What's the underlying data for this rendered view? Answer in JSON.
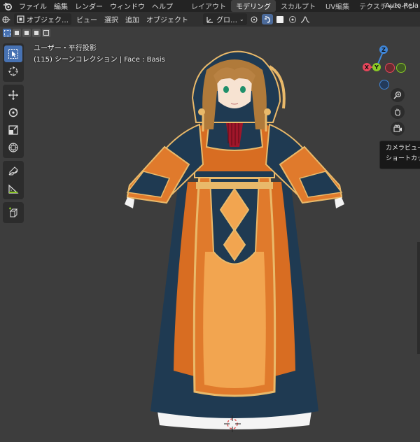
{
  "topbar": {
    "menus": [
      "ファイル",
      "編集",
      "レンダー",
      "ウィンドウ",
      "ヘルプ"
    ],
    "workspace_tabs": [
      {
        "label": "レイアウト",
        "active": false
      },
      {
        "label": "モデリング",
        "active": true
      },
      {
        "label": "スカルプト",
        "active": false
      },
      {
        "label": "UV編集",
        "active": false
      },
      {
        "label": "テクスチャペイン",
        "active": false
      }
    ],
    "right_label": "Auto Rela"
  },
  "header": {
    "mode_dropdown": "オブジェク…",
    "menus": [
      "ビュー",
      "選択",
      "追加",
      "オブジェクト"
    ],
    "orientation_dropdown": "グロ…"
  },
  "viewport": {
    "view_name": "ユーザー・平行投影",
    "collection_info": "(115) シーンコレクション | Face : Basis"
  },
  "gizmo": {
    "z_label": "Z",
    "x_label": "X",
    "y_label": "Y",
    "colors": {
      "x": "#e8465b",
      "y": "#8ac926",
      "z": "#3f86d9"
    }
  },
  "tooltip": {
    "line1": "カメラビュー",
    "line2": "ショートカッ"
  },
  "colors": {
    "accent": "#4772b3",
    "robe_orange": "#e2782f",
    "robe_navy": "#1f3a52",
    "trim_gold": "#e9b96a",
    "hair": "#b07a3a"
  }
}
